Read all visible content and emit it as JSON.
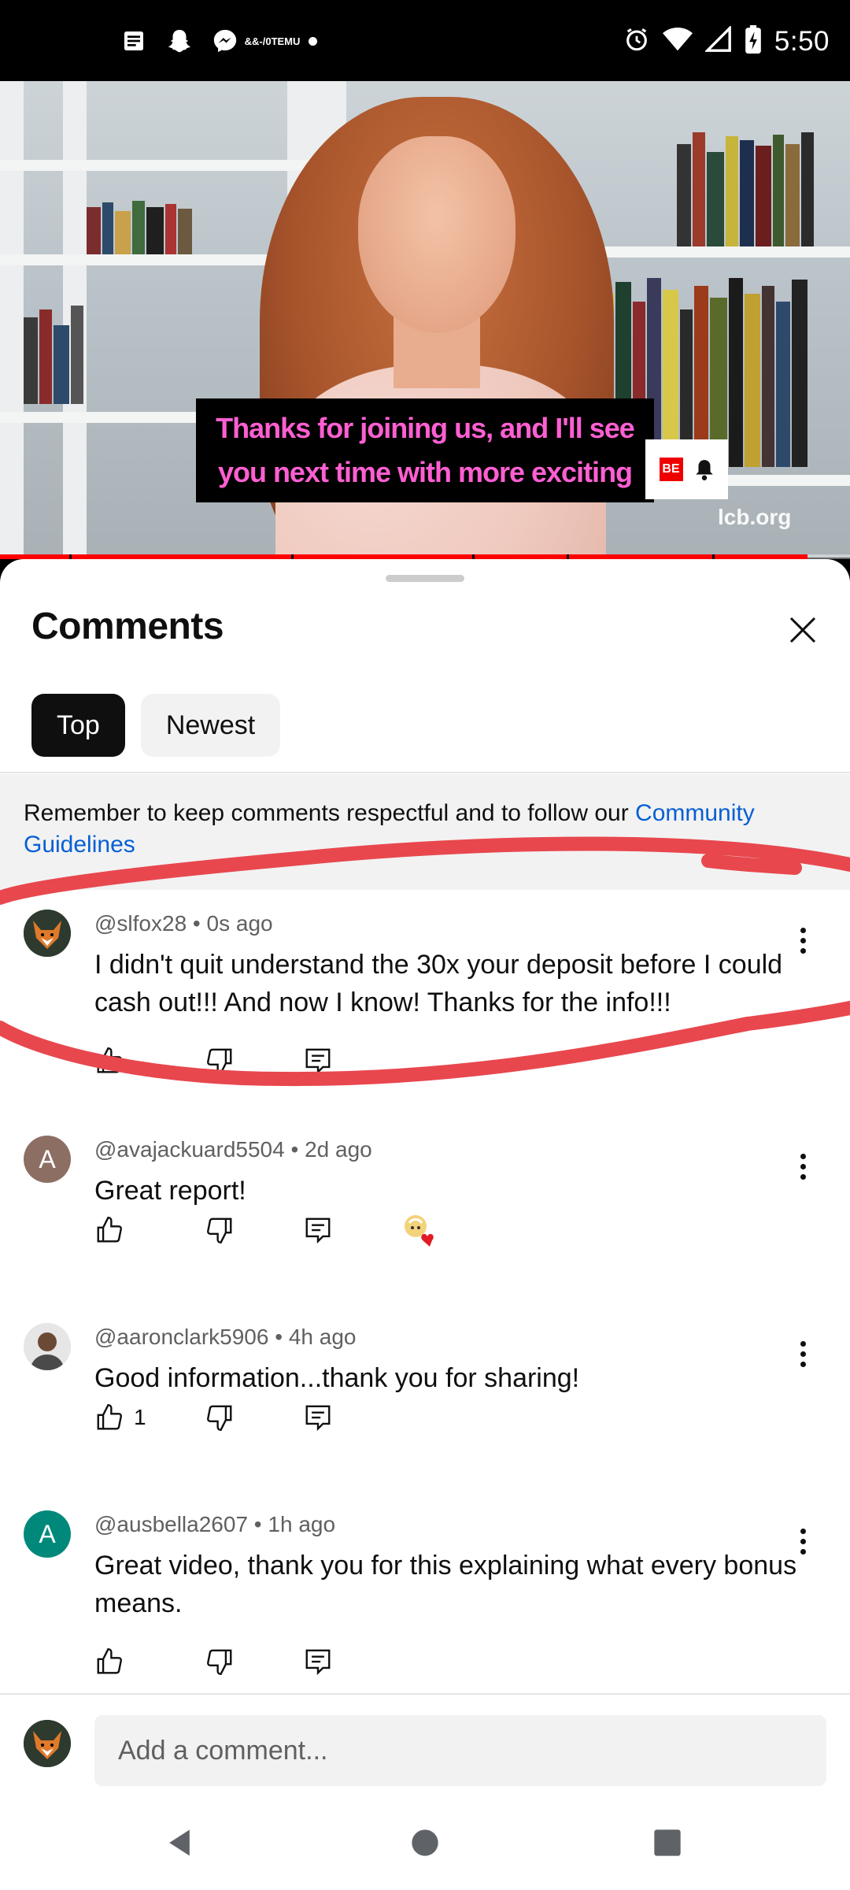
{
  "status_bar": {
    "time": "5:50",
    "left_icons": [
      "news-icon",
      "snapchat-icon",
      "messenger-icon",
      "temu-icon",
      "dot-icon"
    ],
    "temu_label": "TEMU",
    "temu_sublabel": "&&-/0",
    "right_icons": [
      "alarm-icon",
      "wifi-icon",
      "signal-icon",
      "battery-icon"
    ]
  },
  "video": {
    "subtitle_line1": "Thanks for joining us, and I'll see",
    "subtitle_line2": "you next time with more exciting",
    "watermark": "lcb.org",
    "subscribe_fragment": "BE",
    "progress_fraction": 0.95
  },
  "sheet": {
    "title": "Comments",
    "tabs": [
      {
        "label": "Top",
        "active": true
      },
      {
        "label": "Newest",
        "active": false
      }
    ],
    "notice": {
      "text": "Remember to keep comments respectful and to follow our ",
      "link": "Community Guidelines"
    }
  },
  "comments": [
    {
      "handle": "@slfox28",
      "time": "0s ago",
      "text": "I didn't quit understand the 30x your deposit before I could cash out!!!  And now I know! Thanks for the info!!!",
      "likes": "",
      "avatar": "fox",
      "highlighted": true
    },
    {
      "handle": "@avajackuard5504",
      "time": "2d ago",
      "text": "Great report!",
      "likes": "",
      "avatar_letter": "A",
      "avatar_color": "#8d6e63",
      "creator_heart": true
    },
    {
      "handle": "@aaronclark5906",
      "time": "4h ago",
      "text": "Good information...thank you for sharing!",
      "likes": "1",
      "avatar": "photo"
    },
    {
      "handle": "@ausbella2607",
      "time": "1h ago",
      "text": "Great video, thank you for this explaining what every bonus means.",
      "likes": "",
      "avatar_letter": "A",
      "avatar_color": "#00897b"
    }
  ],
  "composer": {
    "placeholder": "Add a comment..."
  },
  "colors": {
    "link": "#065fd4",
    "annotation": "#e8474e",
    "subtitle": "#ff5fd2",
    "progress": "#ff0000"
  }
}
